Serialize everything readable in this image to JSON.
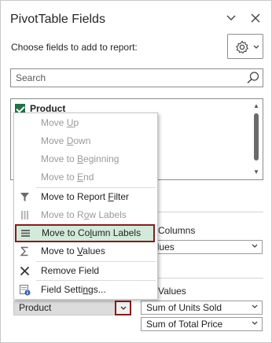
{
  "panel": {
    "title": "PivotTable Fields",
    "subtitle": "Choose fields to add to report:"
  },
  "search": {
    "placeholder": "Search"
  },
  "fields": [
    {
      "label": "Product",
      "checked": true
    }
  ],
  "areas": {
    "columns_label": "Columns",
    "columns_items": [
      "Values"
    ],
    "values_label": "Values",
    "values_items": [
      "Sum of Units Sold",
      "Sum of Total Price"
    ],
    "rows_items": [
      "Product"
    ]
  },
  "context_menu": {
    "items": [
      {
        "pre": "Move ",
        "key": "U",
        "post": "p",
        "enabled": false,
        "icon": "none"
      },
      {
        "pre": "Move ",
        "key": "D",
        "post": "own",
        "enabled": false,
        "icon": "none"
      },
      {
        "pre": "Move to ",
        "key": "B",
        "post": "eginning",
        "enabled": false,
        "icon": "none"
      },
      {
        "pre": "Move to ",
        "key": "E",
        "post": "nd",
        "enabled": false,
        "icon": "none"
      },
      {
        "pre": "Move to Report ",
        "key": "F",
        "post": "ilter",
        "enabled": true,
        "icon": "filter-icon"
      },
      {
        "pre": "Move to R",
        "key": "o",
        "post": "w Labels",
        "enabled": false,
        "icon": "rows-icon"
      },
      {
        "pre": "Move to Co",
        "key": "l",
        "post": "umn Labels",
        "enabled": true,
        "icon": "columns-icon",
        "highlighted": true
      },
      {
        "pre": "Move to ",
        "key": "V",
        "post": "alues",
        "enabled": true,
        "icon": "sigma-icon"
      },
      {
        "pre": "Remove Field",
        "key": "",
        "post": "",
        "enabled": true,
        "icon": "remove-icon"
      },
      {
        "pre": "Field Setti",
        "key": "n",
        "post": "gs...",
        "enabled": true,
        "icon": "field-settings-icon"
      }
    ]
  },
  "colors": {
    "accent_green": "#1f7346",
    "highlight_bg": "#d2ead9",
    "annotation_red": "#8b1a1a"
  }
}
